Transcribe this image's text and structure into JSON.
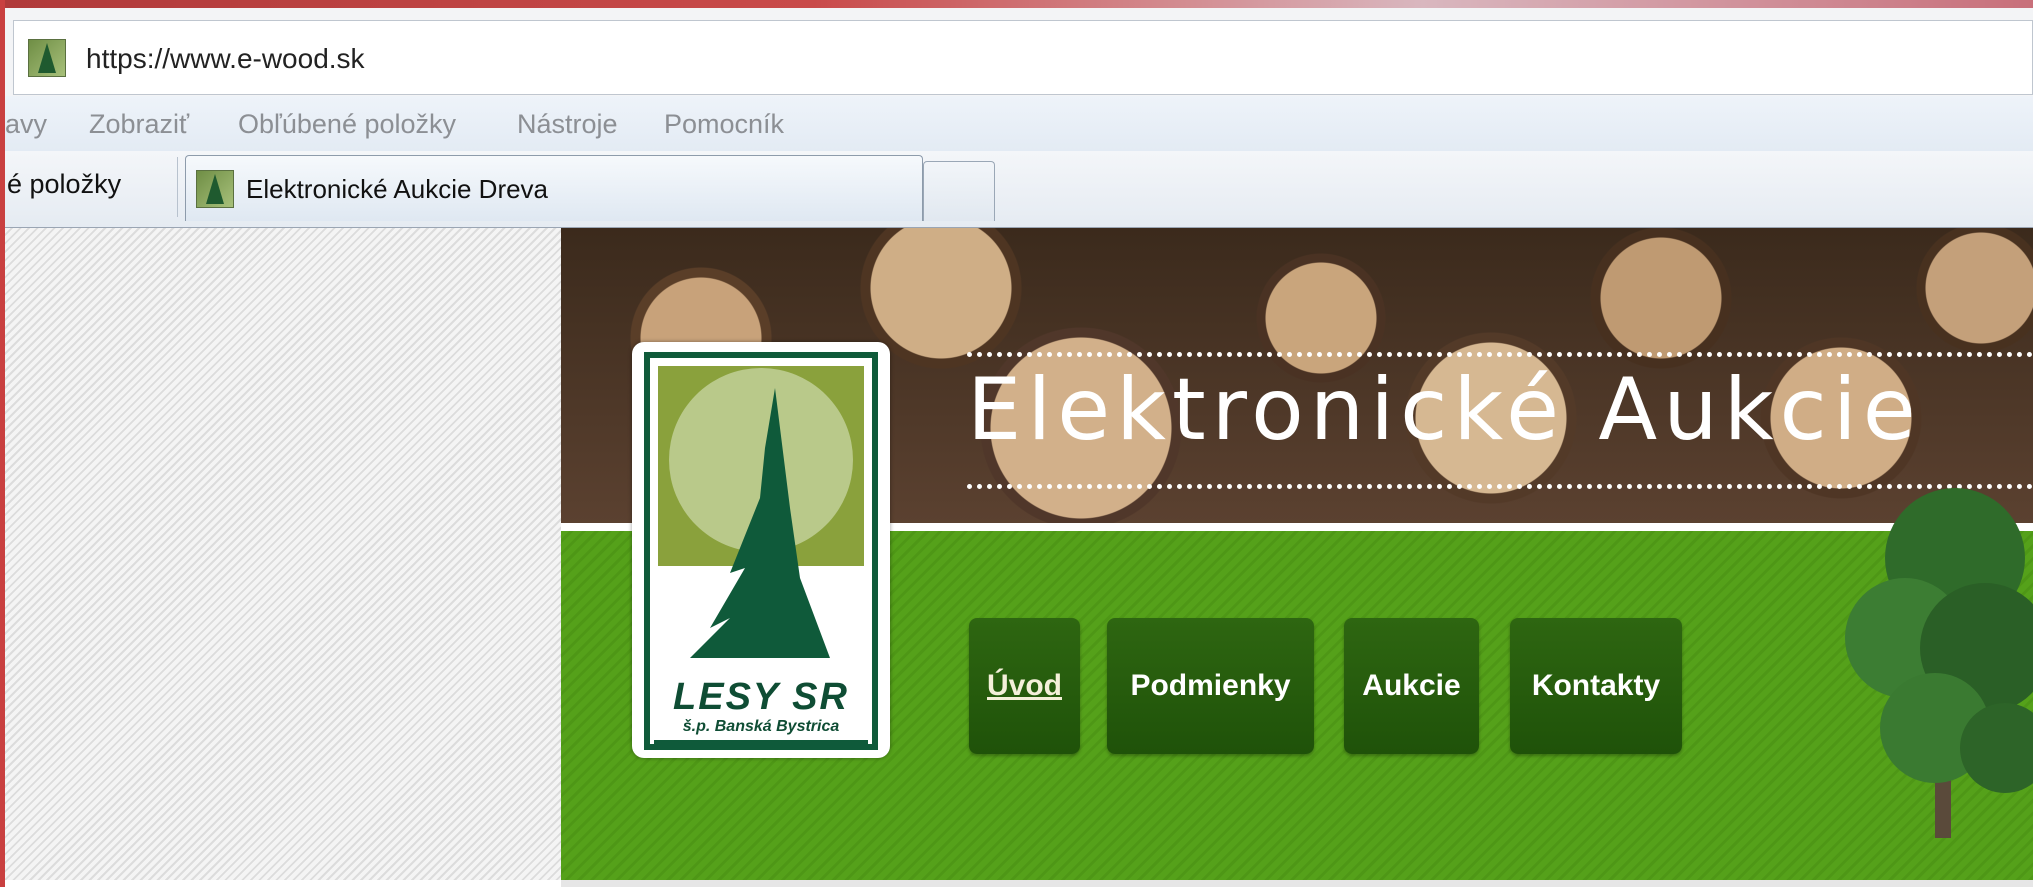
{
  "browser": {
    "address": "https://www.e-wood.sk",
    "menu": [
      "avy",
      "Zobraziť",
      "Obľúbené položky",
      "Nástroje",
      "Pomocník"
    ],
    "favorites_label": "é položky",
    "tab_title": "Elektronické Aukcie Dreva"
  },
  "site": {
    "title": "Elektronické Aukcie",
    "logo": {
      "name": "LESY SR",
      "subtitle": "š.p. Banská Bystrica"
    },
    "nav": [
      {
        "label": "Úvod",
        "active": true
      },
      {
        "label": "Podmienky",
        "active": false
      },
      {
        "label": "Aukcie",
        "active": false
      },
      {
        "label": "Kontakty",
        "active": false
      }
    ]
  },
  "colors": {
    "nav_button": "#2a5f0f",
    "header_green": "#55a11a",
    "logo_green": "#0f5a3a"
  },
  "icons": [
    "site-favicon",
    "tab-favicon",
    "lesy-tree-logo"
  ]
}
